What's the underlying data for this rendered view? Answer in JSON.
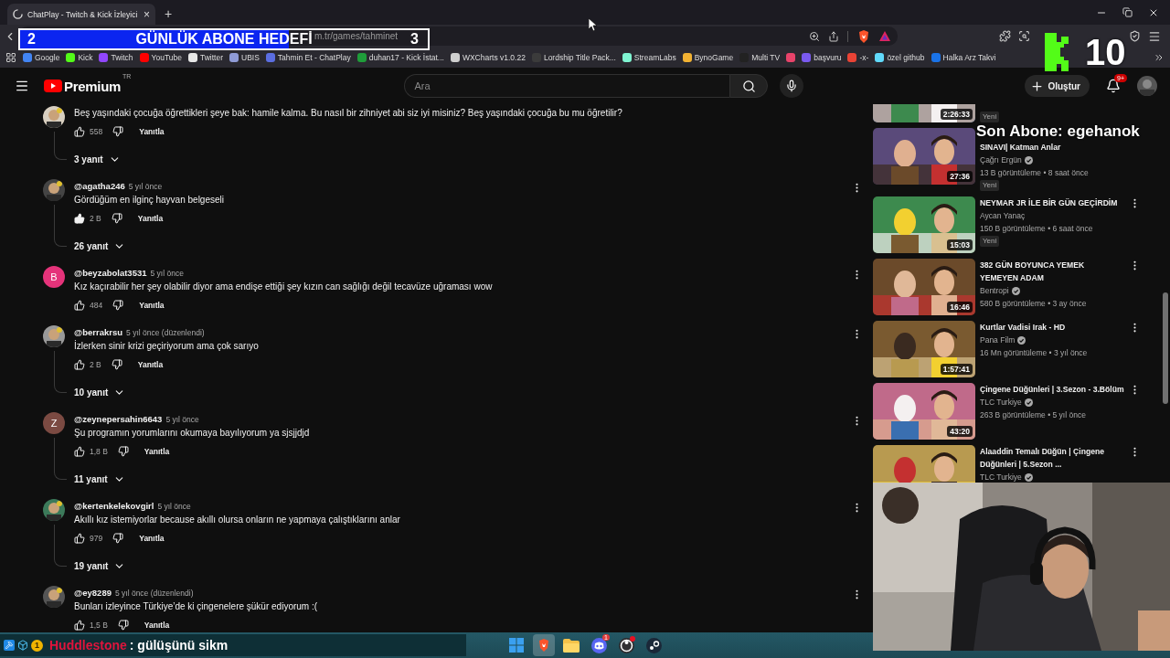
{
  "browser": {
    "tab": {
      "title": "ChatPlay - Twitch & Kick İzleyici",
      "close": "×"
    },
    "new_tab": "+",
    "address": "m.tr/games/tahminet",
    "bookmarks": [
      {
        "label": "Google",
        "color": "#4285f4"
      },
      {
        "label": "Kick",
        "color": "#53fc18"
      },
      {
        "label": "Twitch",
        "color": "#9146ff"
      },
      {
        "label": "YouTube",
        "color": "#ff0000"
      },
      {
        "label": "Twitter",
        "color": "#e7e7e7"
      },
      {
        "label": "UBIS",
        "color": "#8f9bd6"
      },
      {
        "label": "Tahmin Et - ChatPlay",
        "color": "#5b6ee1"
      },
      {
        "label": "duhan17 - Kick İstat...",
        "color": "#1f9d3a"
      },
      {
        "label": "WXCharts v1.0.22",
        "color": "#cfcfcf"
      },
      {
        "label": "Lordship Title Pack...",
        "color": "#3b3b3b"
      },
      {
        "label": "StreamLabs",
        "color": "#80f5d2"
      },
      {
        "label": "BynoGame",
        "color": "#f2b233"
      },
      {
        "label": "Multi TV",
        "color": "#222222"
      },
      {
        "color": "#e8436a"
      },
      {
        "label": "başvuru",
        "color": "#7a5af0"
      },
      {
        "label": "-x-",
        "color": "#ea4335"
      },
      {
        "label": "özel github",
        "color": "#61dafb"
      },
      {
        "label": "Halka Arz Takvi",
        "color": "#1a73e8"
      }
    ]
  },
  "youtube": {
    "logo": "Premium",
    "region": "TR",
    "search": {
      "placeholder": "Ara"
    },
    "create": "Oluştur",
    "notifications": "9+"
  },
  "comments": [
    {
      "text": "Beş yaşındaki çocuğa öğrettikleri şeye bak: hamile kalma. Bu nasıl bir zihniyet abi siz iyi misiniz? Beş yaşındaki çocuğa bu mu öğretilir?",
      "likes": "558",
      "liked": false,
      "reply": "Yanıtla",
      "replies": "3 yanıt"
    },
    {
      "author": "@agatha246",
      "time": "5 yıl önce",
      "text": "Gördüğüm en ilginç hayvan belgeseli",
      "likes": "2 B",
      "liked": true,
      "reply": "Yanıtla",
      "replies": "26 yanıt"
    },
    {
      "avatar": {
        "kind": "letter",
        "letter": "B",
        "color": "#e5337a"
      },
      "author": "@beyzabolat3531",
      "time": "5 yıl önce",
      "text": "Kız kaçırabilir her şey olabilir diyor ama endişe ettiği şey kızın can sağlığı değil tecavüze uğraması wow",
      "likes": "484",
      "liked": false,
      "reply": "Yanıtla"
    },
    {
      "author": "@berrakrsu",
      "time": "5 yıl önce (düzenlendi)",
      "text": "İzlerken sinir krizi geçiriyorum ama çok sarıyo",
      "likes": "2 B",
      "liked": false,
      "reply": "Yanıtla",
      "replies": "10 yanıt"
    },
    {
      "avatar": {
        "kind": "letter",
        "letter": "Z",
        "color": "#7b4a42"
      },
      "author": "@zeynepersahin6643",
      "time": "5 yıl önce",
      "text": "Şu programın yorumlarını okumaya bayılıyorum ya sjsjjdjd",
      "likes": "1,8 B",
      "liked": false,
      "reply": "Yanıtla",
      "replies": "11 yanıt"
    },
    {
      "author": "@kertenkelekovgirl",
      "time": "5 yıl önce",
      "text": "Akıllı kız istemiyorlar because akıllı olursa onların ne yapmaya çalıştıklarını anlar",
      "likes": "979",
      "liked": false,
      "reply": "Yanıtla",
      "replies": "19 yanıt"
    },
    {
      "author": "@ey8289",
      "time": "5 yıl önce (düzenlendi)",
      "text": "Bunları izleyince Türkiye’de ki çingenelere şükür ediyorum :(",
      "likes": "1,5 B",
      "liked": false,
      "reply": "Yanıtla"
    }
  ],
  "sidebar": [
    {
      "duration": "2:26:33",
      "badge": "Yeni",
      "menu": false
    },
    {
      "covered": true,
      "title": "SINAVI| Katman Anlar",
      "channel": "Çağrı Ergün",
      "verified": true,
      "meta": "13 B görüntüleme • 8 saat önce",
      "badge": "Yeni",
      "duration": "27:36",
      "menu": false
    },
    {
      "covered": false,
      "title": "NEYMAR JR İLE BİR GÜN GEÇİRDİM",
      "channel": "Aycan Yanaç",
      "verified": false,
      "meta": "150 B görüntüleme • 6 saat önce",
      "badge": "Yeni",
      "duration": "15:03",
      "menu": true
    },
    {
      "covered": false,
      "title": "382 GÜN BOYUNCA YEMEK YEMEYEN ADAM",
      "channel": "Bentropi",
      "verified": true,
      "meta": "580 B görüntüleme • 3 ay önce",
      "duration": "16:46",
      "menu": true
    },
    {
      "covered": false,
      "title": "Kurtlar Vadisi Irak - HD",
      "channel": "Pana Film",
      "verified": true,
      "meta": "16 Mn görüntüleme • 3 yıl önce",
      "duration": "1:57:41",
      "menu": true
    },
    {
      "covered": false,
      "title": "Çingene Düğünleri | 3.Sezon - 3.Bölüm",
      "channel": "TLC Turkiye",
      "verified": true,
      "meta": "263 B görüntüleme • 5 yıl önce",
      "duration": "43:20",
      "menu": true
    },
    {
      "covered": false,
      "title": "Alaaddin Temalı Düğün | Çingene Düğünleri | 5.Sezon ...",
      "channel": "TLC Turkiye",
      "verified": true,
      "menu": true
    }
  ],
  "overlay": {
    "goal": {
      "current": "2",
      "title": "GÜNLÜK ABONE HEDEFİ",
      "target": "3",
      "level": 0.66
    },
    "kick_count": "10",
    "last_sub": "Son Abone: egehanok",
    "chat": {
      "badge": "1",
      "user": "Huddlestone",
      "message": ": gülüşünü sikm"
    }
  },
  "taskbar": [
    {
      "kind": "windows",
      "selected": false,
      "dot": false
    },
    {
      "kind": "brave",
      "selected": true,
      "dot": false
    },
    {
      "kind": "folder",
      "selected": false,
      "dot": false
    },
    {
      "kind": "discord",
      "selected": false,
      "dot": false,
      "badge": "1"
    },
    {
      "kind": "obs",
      "selected": false,
      "dot": true
    },
    {
      "kind": "steam",
      "selected": false,
      "dot": false
    }
  ]
}
